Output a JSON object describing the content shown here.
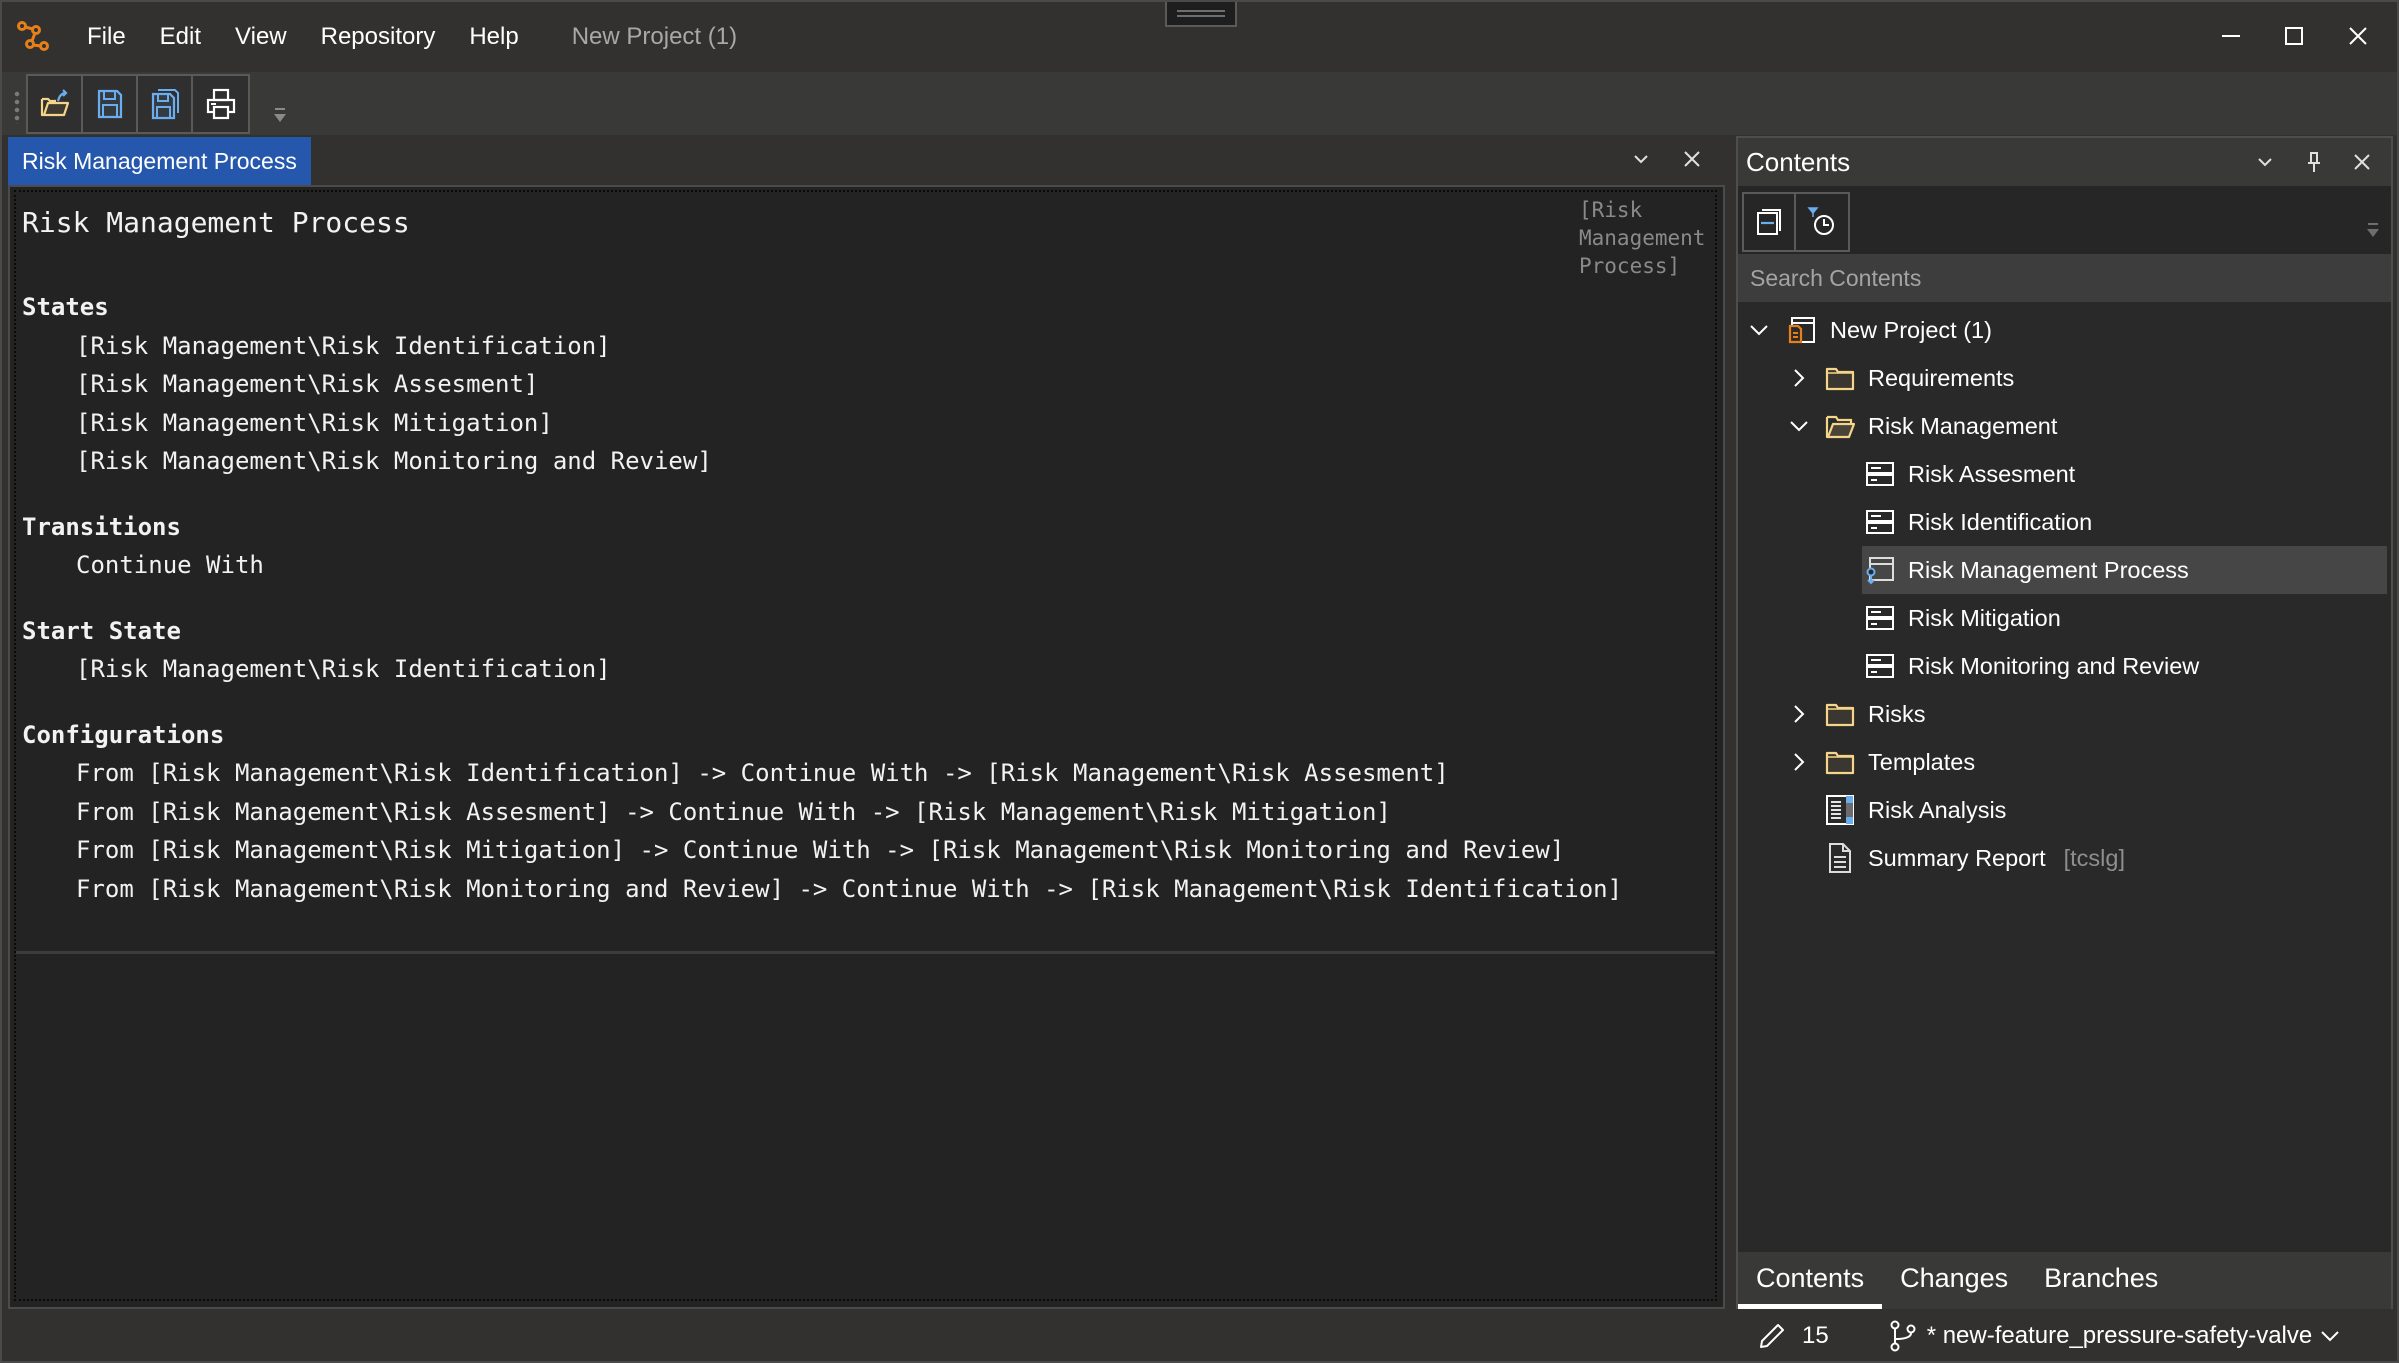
{
  "app": {
    "logo_icon": "app-logo-icon",
    "document_title": "New Project (1)"
  },
  "menu": [
    "File",
    "Edit",
    "View",
    "Repository",
    "Help"
  ],
  "window_controls": {
    "minimize": "—",
    "maximize": "☐",
    "close": "✕"
  },
  "toolbar": {
    "buttons": [
      {
        "name": "open-icon",
        "tooltip": "Open"
      },
      {
        "name": "save-icon",
        "tooltip": "Save"
      },
      {
        "name": "save-all-icon",
        "tooltip": "Save All"
      },
      {
        "name": "print-icon",
        "tooltip": "Print"
      }
    ]
  },
  "document": {
    "tab_label": "Risk Management Process",
    "heading": "Risk Management Process",
    "side_note": "[Risk\nManagement\nProcess]",
    "sections": [
      {
        "title": "States",
        "lines": [
          "[Risk Management\\Risk Identification]",
          "[Risk Management\\Risk Assesment]",
          "[Risk Management\\Risk Mitigation]",
          "[Risk Management\\Risk Monitoring and Review]"
        ]
      },
      {
        "title": "Transitions",
        "lines": [
          "Continue With"
        ]
      },
      {
        "title": "Start State",
        "lines": [
          "[Risk Management\\Risk Identification]"
        ]
      },
      {
        "title": "Configurations",
        "lines": [
          "From [Risk Management\\Risk Identification] -> Continue With -> [Risk Management\\Risk Assesment]",
          "From [Risk Management\\Risk Assesment] -> Continue With -> [Risk Management\\Risk Mitigation]",
          "From [Risk Management\\Risk Mitigation] -> Continue With -> [Risk Management\\Risk Monitoring and Review]",
          "From [Risk Management\\Risk Monitoring and Review] -> Continue With -> [Risk Management\\Risk Identification]"
        ]
      }
    ]
  },
  "contents_panel": {
    "title": "Contents",
    "search_placeholder": "Search Contents",
    "tree": [
      {
        "label": "New Project (1)",
        "level": 0,
        "expander": "expanded",
        "icon": "project-icon"
      },
      {
        "label": "Requirements",
        "level": 1,
        "expander": "collapsed",
        "icon": "folder-icon"
      },
      {
        "label": "Risk Management",
        "level": 1,
        "expander": "expanded",
        "icon": "folder-open-icon"
      },
      {
        "label": "Risk Assesment",
        "level": 2,
        "expander": "none",
        "icon": "state-icon"
      },
      {
        "label": "Risk Identification",
        "level": 2,
        "expander": "none",
        "icon": "state-icon"
      },
      {
        "label": "Risk Management Process",
        "level": 2,
        "expander": "none",
        "icon": "workflow-icon",
        "selected": true
      },
      {
        "label": "Risk Mitigation",
        "level": 2,
        "expander": "none",
        "icon": "state-icon"
      },
      {
        "label": "Risk Monitoring and Review",
        "level": 2,
        "expander": "none",
        "icon": "state-icon"
      },
      {
        "label": "Risks",
        "level": 1,
        "expander": "collapsed",
        "icon": "folder-icon"
      },
      {
        "label": "Templates",
        "level": 1,
        "expander": "collapsed",
        "icon": "folder-icon"
      },
      {
        "label": "Risk Analysis",
        "level": 1,
        "expander": "none",
        "icon": "list-view-icon"
      },
      {
        "label": "Summary Report",
        "level": 1,
        "expander": "none",
        "icon": "report-icon",
        "tag": "[tcslg]"
      }
    ],
    "bottom_tabs": [
      {
        "label": "Contents",
        "active": true
      },
      {
        "label": "Changes",
        "active": false
      },
      {
        "label": "Branches",
        "active": false
      }
    ]
  },
  "status": {
    "edit_count": "15",
    "branch": "* new-feature_pressure-safety-valve"
  },
  "colors": {
    "accent_tab": "#2558ad",
    "folder": "#f5d58a",
    "project_icon": "#e8801a",
    "link_blue": "#6aaef0"
  }
}
